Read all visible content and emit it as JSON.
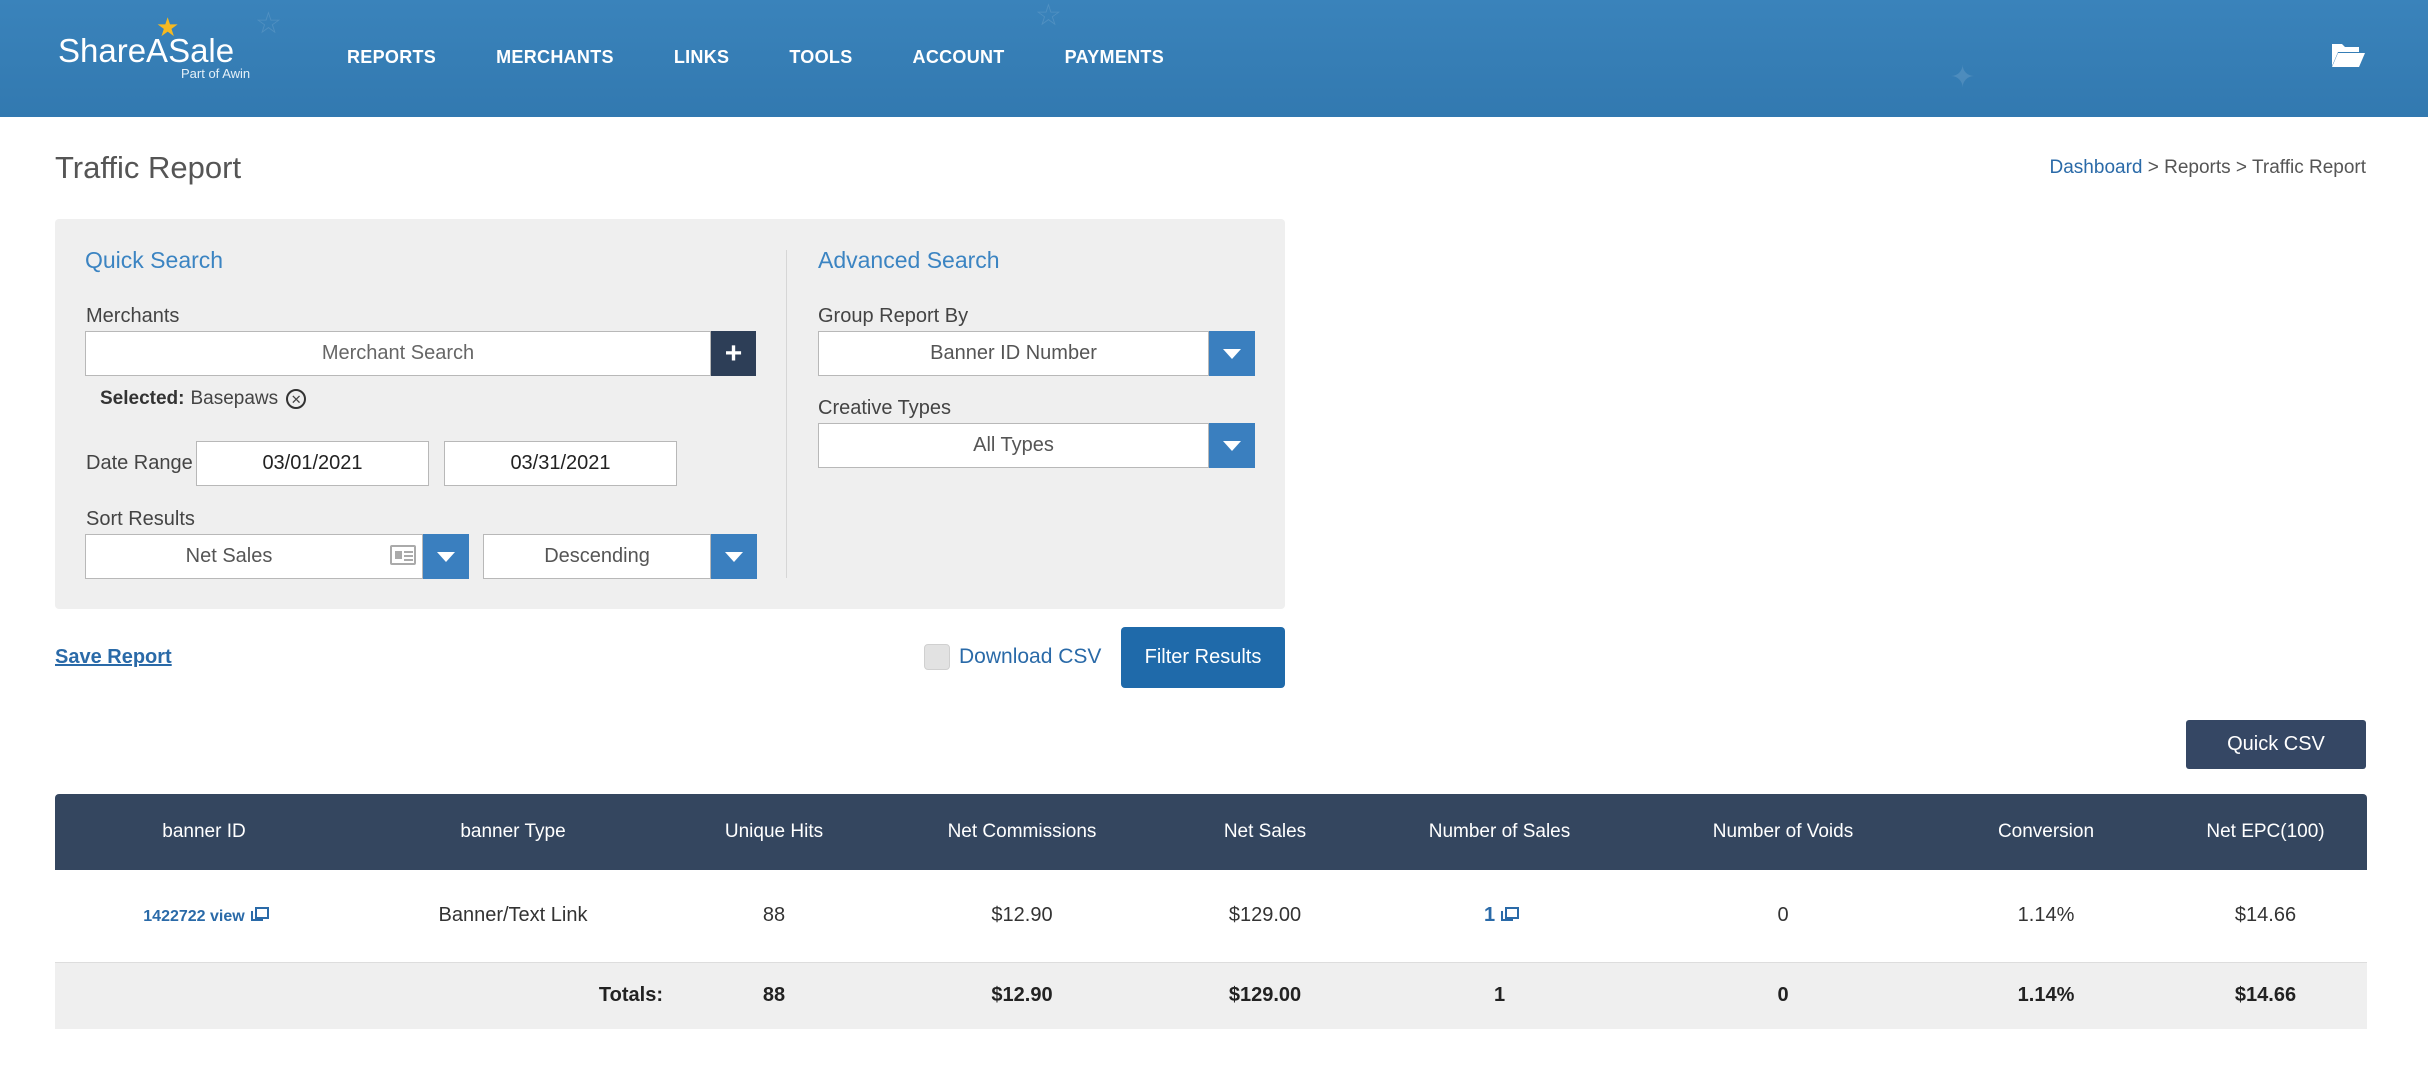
{
  "header": {
    "logo_text": "ShareASale",
    "logo_sub": "Part of Awin",
    "nav": [
      "REPORTS",
      "MERCHANTS",
      "LINKS",
      "TOOLS",
      "ACCOUNT",
      "PAYMENTS"
    ]
  },
  "page": {
    "title": "Traffic Report",
    "breadcrumb": {
      "link": "Dashboard",
      "rest": " > Reports > Traffic Report"
    }
  },
  "quick_search": {
    "title": "Quick Search",
    "merchants_label": "Merchants",
    "merchant_placeholder": "Merchant Search",
    "selected_label": "Selected:",
    "selected_value": "Basepaws",
    "date_range_label": "Date Range",
    "date_from": "03/01/2021",
    "date_to": "03/31/2021",
    "sort_label": "Sort Results",
    "sort_by": "Net Sales",
    "sort_order": "Descending"
  },
  "advanced_search": {
    "title": "Advanced Search",
    "group_label": "Group Report By",
    "group_value": "Banner ID Number",
    "creative_label": "Creative Types",
    "creative_value": "All Types"
  },
  "actions": {
    "save_report": "Save Report",
    "download_csv": "Download CSV",
    "filter_results": "Filter Results",
    "quick_csv": "Quick CSV"
  },
  "table": {
    "columns": [
      "banner ID",
      "banner Type",
      "Unique Hits",
      "Net Commissions",
      "Net Sales",
      "Number of Sales",
      "Number of Voids",
      "Conversion",
      "Net EPC(100)"
    ],
    "row": {
      "banner_id": "1422722 view",
      "banner_type": "Banner/Text Link",
      "unique_hits": "88",
      "net_commissions": "$12.90",
      "net_sales": "$129.00",
      "number_of_sales": "1",
      "number_of_voids": "0",
      "conversion": "1.14%",
      "net_epc": "$14.66"
    },
    "totals": {
      "label": "Totals:",
      "unique_hits": "88",
      "net_commissions": "$12.90",
      "net_sales": "$129.00",
      "number_of_sales": "1",
      "number_of_voids": "0",
      "conversion": "1.14%",
      "net_epc": "$14.66"
    }
  },
  "colors": {
    "header_bg": "#3279b0",
    "accent_blue": "#1f6aaa",
    "table_header": "#34465f",
    "link": "#2a6aa8",
    "logo_star": "#f6b920"
  }
}
